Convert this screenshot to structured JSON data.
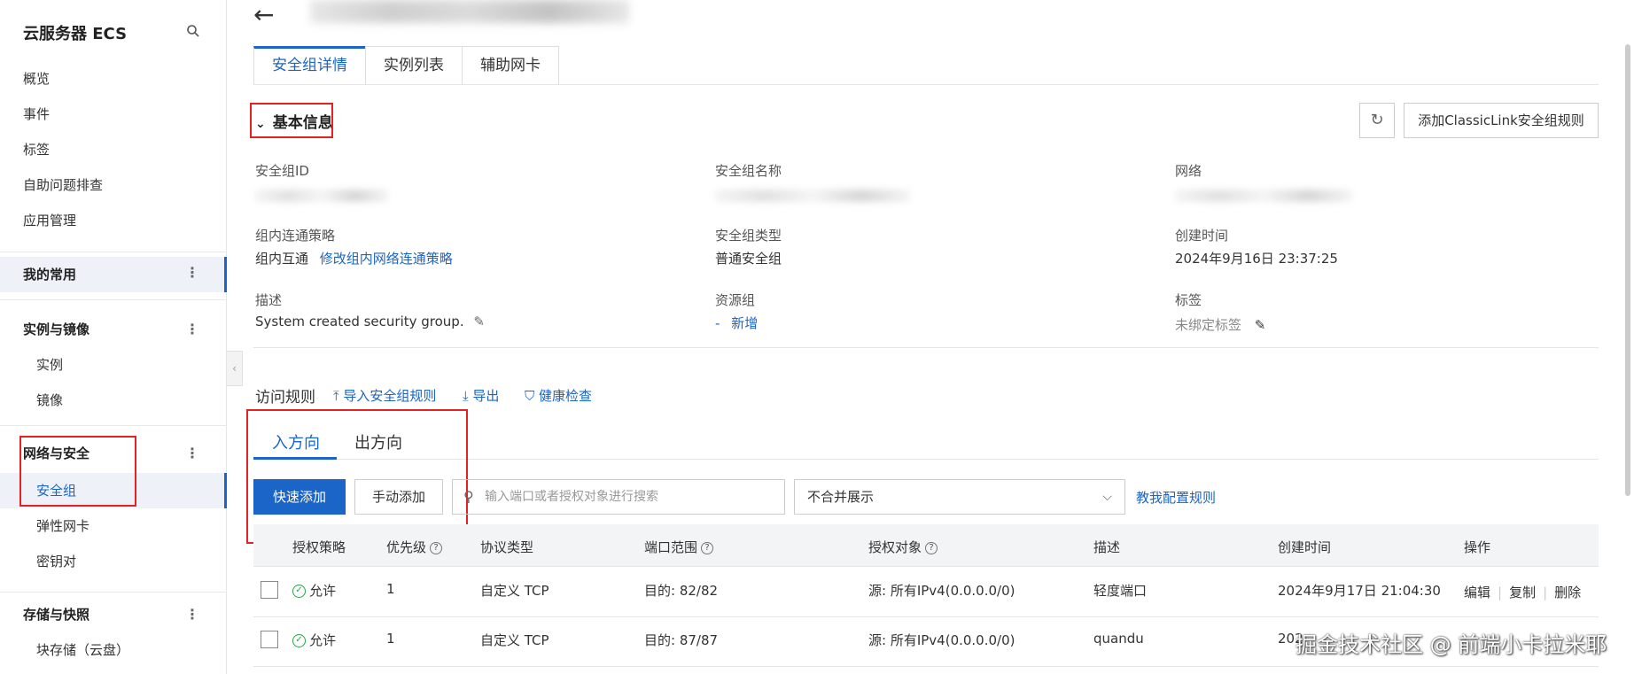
{
  "sidebar": {
    "title": "云服务器 ECS",
    "top_items": [
      "概览",
      "事件",
      "标签",
      "自助问题排查",
      "应用管理"
    ],
    "groups": {
      "favorites": "我的常用",
      "instances": {
        "label": "实例与镜像",
        "items": [
          "实例",
          "镜像"
        ]
      },
      "network": {
        "label": "网络与安全",
        "items": [
          "安全组",
          "弹性网卡",
          "密钥对"
        ]
      },
      "storage": {
        "label": "存储与快照",
        "items": [
          "块存储（云盘）"
        ]
      }
    },
    "more_glyph": "⋮"
  },
  "header": {
    "back_glyph": "←",
    "tabs": [
      "安全组详情",
      "实例列表",
      "辅助网卡"
    ]
  },
  "basic_info": {
    "title": "基本信息",
    "add_classic_label": "添加ClassicLink安全组规则",
    "fields": {
      "sg_id_label": "安全组ID",
      "sg_name_label": "安全组名称",
      "network_label": "网络",
      "policy_label": "组内连通策略",
      "policy_value": "组内互通",
      "policy_link": "修改组内网络连通策略",
      "type_label": "安全组类型",
      "type_value": "普通安全组",
      "created_label": "创建时间",
      "created_value": "2024年9月16日 23:37:25",
      "desc_label": "描述",
      "desc_value": "System created security group.",
      "rg_label": "资源组",
      "rg_value": "-",
      "rg_add": "新增",
      "tag_label": "标签",
      "tag_value": "未绑定标签"
    }
  },
  "rules": {
    "title": "访问规则",
    "actions": [
      "导入安全组规则",
      "导出",
      "健康检查"
    ],
    "direction_tabs": [
      "入方向",
      "出方向"
    ],
    "quick_add": "快速添加",
    "manual_add": "手动添加",
    "search_placeholder": "输入端口或者授权对象进行搜索",
    "merge_select": "不合并展示",
    "teach_link": "教我配置规则",
    "columns": [
      "授权策略",
      "优先级",
      "协议类型",
      "端口范围",
      "授权对象",
      "描述",
      "创建时间",
      "操作"
    ],
    "rows": [
      {
        "policy": "允许",
        "priority": "1",
        "protocol": "自定义 TCP",
        "port": "目的: 82/82",
        "source": "源: 所有IPv4(0.0.0.0/0)",
        "desc": "轻度端口",
        "created": "2024年9月17日 21:04:30",
        "ops": [
          "编辑",
          "复制",
          "删除"
        ]
      },
      {
        "policy": "允许",
        "priority": "1",
        "protocol": "自定义 TCP",
        "port": "目的: 87/87",
        "source": "源: 所有IPv4(0.0.0.0/0)",
        "desc": "quandu",
        "created": "202",
        "ops": []
      }
    ]
  },
  "watermark": "掘金技术社区 @ 前端小卡拉米耶",
  "colors": {
    "accent": "#1a65c7",
    "highlight": "#e52222",
    "success": "#2aa34a"
  }
}
